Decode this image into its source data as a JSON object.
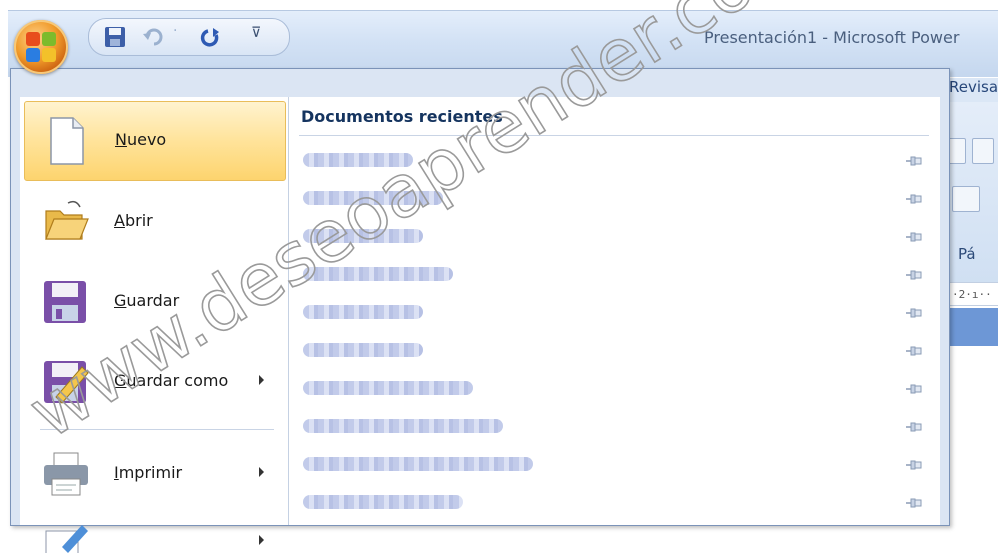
{
  "window": {
    "title": "Presentación1 - Microsoft Power"
  },
  "ribbon": {
    "tab_partial": "Revisa",
    "group_label_partial": "Pá",
    "ruler_text": "·2·ı··"
  },
  "office_menu": {
    "items": [
      {
        "label": "Nuevo",
        "icon": "new-document-icon",
        "has_submenu": false
      },
      {
        "label": "Abrir",
        "icon": "open-folder-icon",
        "has_submenu": false
      },
      {
        "label": "Guardar",
        "icon": "save-disk-icon",
        "has_submenu": false
      },
      {
        "label": "Guardar como",
        "icon": "save-as-icon",
        "has_submenu": true
      },
      {
        "label": "Imprimir",
        "icon": "printer-icon",
        "has_submenu": true
      },
      {
        "label": "",
        "icon": "prepare-icon",
        "has_submenu": true
      }
    ],
    "recent": {
      "title": "Documentos recientes",
      "rows": 10
    }
  },
  "watermark": {
    "text": "www.deseoaprender.com"
  },
  "colors": {
    "menu_highlight": "#ffe39a",
    "menu_bg": "#dbe5f3",
    "office_orange": "#f09a2a",
    "ribbon_blue": "#6d97d6"
  }
}
